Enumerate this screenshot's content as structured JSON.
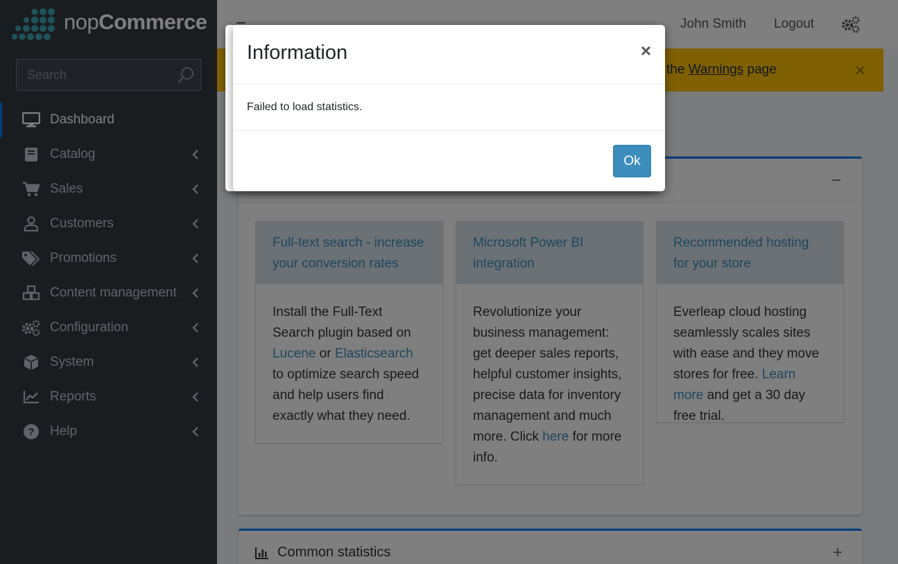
{
  "header": {
    "logo_text_light": "nop",
    "logo_text_bold": "Commerce",
    "user_name": "John Smith",
    "logout_label": "Logout"
  },
  "sidebar": {
    "search_placeholder": "Search",
    "items": [
      {
        "label": "Dashboard",
        "icon": "desktop-icon",
        "active": true
      },
      {
        "label": "Catalog",
        "icon": "book-icon"
      },
      {
        "label": "Sales",
        "icon": "cart-icon"
      },
      {
        "label": "Customers",
        "icon": "user-icon"
      },
      {
        "label": "Promotions",
        "icon": "tags-icon"
      },
      {
        "label": "Content management",
        "icon": "cubes-icon"
      },
      {
        "label": "Configuration",
        "icon": "gears-icon"
      },
      {
        "label": "System",
        "icon": "cube-icon"
      },
      {
        "label": "Reports",
        "icon": "line-chart-icon"
      },
      {
        "label": "Help",
        "icon": "question-circle-icon"
      }
    ]
  },
  "alert": {
    "prefix": "the",
    "link": "Warnings",
    "suffix": "page"
  },
  "tiles": [
    {
      "title": "Full-text search - increase your conversion rates",
      "body_1": "Install the Full-Text Search plugin based on",
      "link_1": "Lucene",
      "body_2": "or",
      "link_2": "Elasticsearch",
      "body_3": "to optimize search speed and help users find exactly what they need."
    },
    {
      "title": "Microsoft Power BI integration",
      "body_1": "Revolutionize your business management: get deeper sales reports, helpful customer insights, precise data for inventory management and much more. Click",
      "link_1": "here",
      "body_2": "for more info."
    },
    {
      "title": "Recommended hosting for your store",
      "body_1": "Everleap cloud hosting seamlessly scales sites with ease and they move stores for free.",
      "link_1": "Learn more",
      "body_2": "and get a 30 day free trial."
    }
  ],
  "common_statistics": {
    "title": "Common statistics"
  },
  "modal": {
    "title": "Information",
    "close_glyph": "×",
    "message": "Failed to load statistics.",
    "ok_label": "Ok"
  },
  "colors": {
    "sidebar_bg": "#343a40",
    "accent": "#3c8dbc",
    "alert_bg": "#ffc107",
    "primary": "#007bff"
  }
}
